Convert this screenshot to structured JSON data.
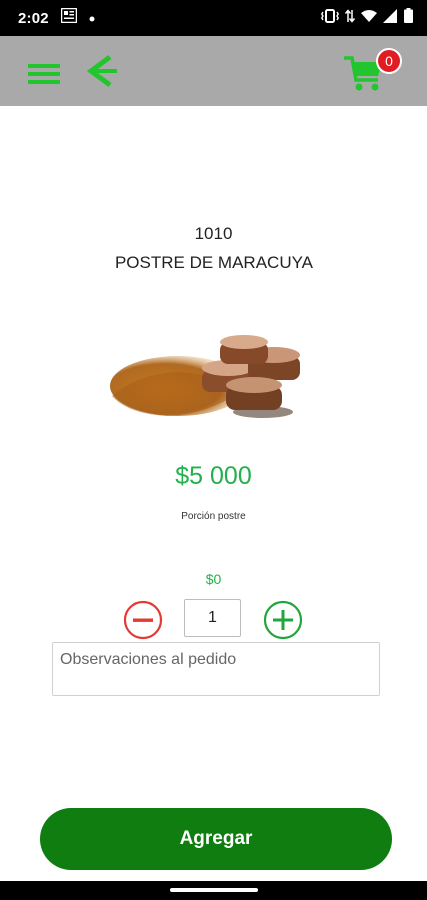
{
  "status_bar": {
    "time": "2:02",
    "icons": [
      "news-icon",
      "dot-icon",
      "vibrate-icon",
      "data-arrows-icon",
      "wifi-icon",
      "signal-icon",
      "battery-icon"
    ]
  },
  "header": {
    "cart_count": "0",
    "icons": [
      "menu-icon",
      "back-arrow-icon",
      "cart-icon"
    ],
    "accent_color": "#22c52e",
    "background_color": "#a9a9a9"
  },
  "product": {
    "code": "1010",
    "name": "POSTRE DE MARACUYA",
    "price": "$5 000",
    "portion": "Porción postre"
  },
  "order": {
    "subtotal": "$0",
    "quantity": "1",
    "observations_placeholder": "Observaciones al pedido",
    "add_label": "Agregar",
    "add_button_color": "#0f7d0f"
  }
}
